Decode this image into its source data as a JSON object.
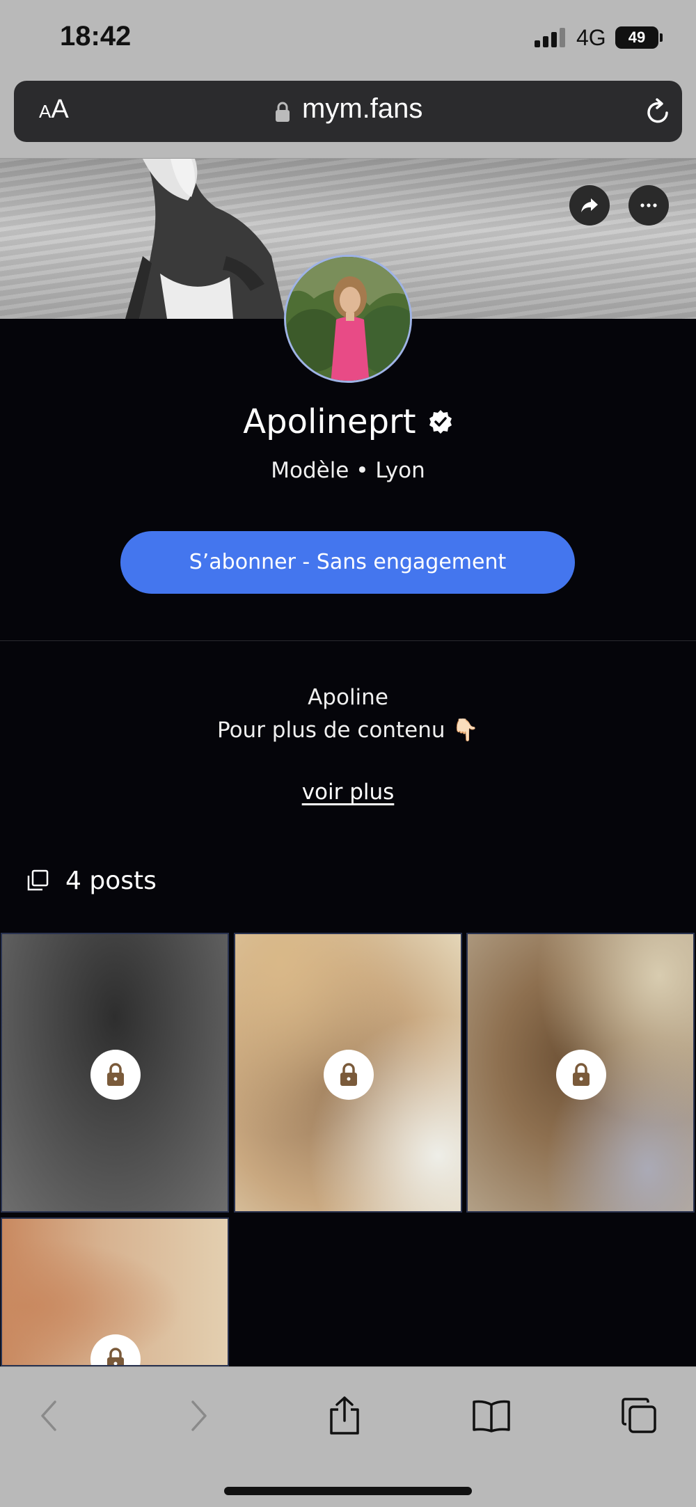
{
  "status_bar": {
    "time": "18:42",
    "network": "4G",
    "battery": "49"
  },
  "browser": {
    "text_size_label_small": "A",
    "text_size_label_large": "A",
    "url": "mym.fans"
  },
  "profile": {
    "name": "Apolineprt",
    "subtitle": "Modèle • Lyon",
    "subscribe_label": "S’abonner - Sans engagement",
    "bio_line_1": "Apoline",
    "bio_line_2": "Pour plus de contenu 👇🏻",
    "see_more": "voir plus",
    "posts_label": "4 posts"
  },
  "posts": [
    {
      "locked": true
    },
    {
      "locked": true
    },
    {
      "locked": true
    },
    {
      "locked": true
    }
  ],
  "colors": {
    "accent": "#4476ee",
    "page_bg": "#05050a",
    "chrome_bg": "#b9b9b9"
  },
  "icons": {
    "share": "share-arrow-icon",
    "more": "ellipsis-icon",
    "verified": "verified-badge-icon",
    "posts": "stacked-squares-icon",
    "lock": "lock-icon"
  }
}
